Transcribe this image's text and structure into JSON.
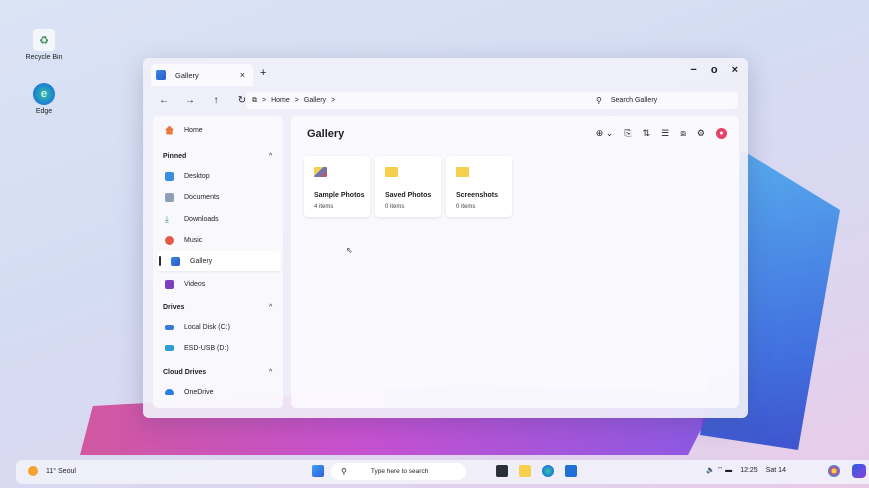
{
  "desktop": {
    "icons": [
      {
        "label": "Recycle Bin",
        "icon": "recycle-bin-icon"
      },
      {
        "label": "Edge",
        "icon": "edge-icon"
      }
    ]
  },
  "window": {
    "tab_title": "Gallery",
    "tab_close": "×",
    "new_tab": "+",
    "controls": {
      "minimize": "−",
      "maximize": "o",
      "close": "×"
    },
    "nav": {
      "back": "←",
      "forward": "→",
      "up": "↑",
      "refresh": "↻",
      "view": "⧉"
    },
    "breadcrumb": {
      "sep": ">",
      "items": [
        "Home",
        "Gallery"
      ]
    },
    "search_placeholder": "Search Gallery",
    "sidebar": {
      "home": "Home",
      "pinned_header": "Pinned",
      "pinned": [
        "Desktop",
        "Documents",
        "Downloads",
        "Music",
        "Gallery",
        "Videos"
      ],
      "drives_header": "Drives",
      "drives": [
        "Local Disk (C:)",
        "ESD-USB (D:)"
      ],
      "cloud_header": "Cloud Drives",
      "cloud": [
        "OneDrive"
      ],
      "caret": "^"
    },
    "content": {
      "title": "Gallery",
      "toolbar": [
        "⊕ ⌄",
        "⎘",
        "⇅",
        "☰",
        "⧈",
        "⚙",
        "●"
      ],
      "folders": [
        {
          "name": "Sample Photos",
          "count": "4 items"
        },
        {
          "name": "Saved Photos",
          "count": "0 items"
        },
        {
          "name": "Screenshots",
          "count": "0 items"
        }
      ]
    }
  },
  "taskbar": {
    "weather": "11° Seoul",
    "search_placeholder": "Type here to search",
    "search_icon": "search-icon",
    "tray_icons": "🔈 ⌔ ▬",
    "time": "12:25",
    "date": "Sat 14"
  },
  "colors": {
    "accent": "#2f63dd",
    "folder": "#f6cf4d",
    "record": "#e54366"
  }
}
